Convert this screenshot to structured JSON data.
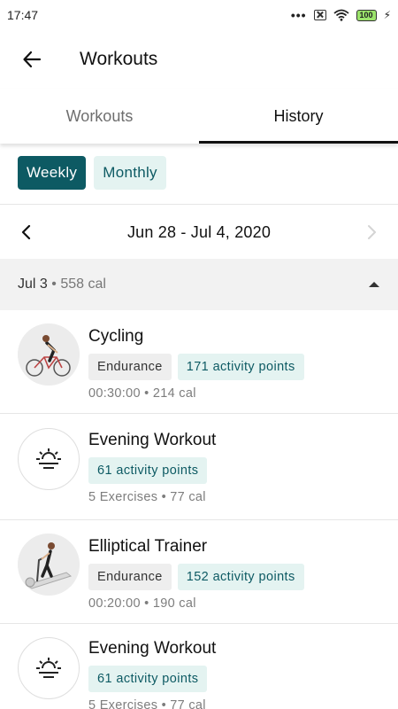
{
  "status_bar": {
    "time": "17:47",
    "more": "•••",
    "battery": "100"
  },
  "header": {
    "title": "Workouts"
  },
  "tabs": [
    {
      "label": "Workouts",
      "active": false
    },
    {
      "label": "History",
      "active": true
    }
  ],
  "period": {
    "weekly": "Weekly",
    "monthly": "Monthly",
    "selected": "Weekly"
  },
  "week_nav": {
    "range": "Jun 28 - Jul 4, 2020"
  },
  "day_group": {
    "date": "Jul 3",
    "separator": "•",
    "calories": "558 cal"
  },
  "workouts": [
    {
      "title": "Cycling",
      "category": "Endurance",
      "points": "171 activity points",
      "meta": "00:30:00 • 214 cal",
      "icon": "cycling-photo"
    },
    {
      "title": "Evening Workout",
      "category": "",
      "points": "61 activity points",
      "meta": "5 Exercises • 77 cal",
      "icon": "sunset-icon"
    },
    {
      "title": "Elliptical Trainer",
      "category": "Endurance",
      "points": "152 activity points",
      "meta": "00:20:00 • 190 cal",
      "icon": "elliptical-photo"
    },
    {
      "title": "Evening Workout",
      "category": "",
      "points": "61 activity points",
      "meta": "5 Exercises • 77 cal",
      "icon": "sunset-icon"
    }
  ],
  "colors": {
    "accent": "#0d5a63",
    "accent_light": "#e4f3f1",
    "group_bg": "#f2f2f2"
  }
}
